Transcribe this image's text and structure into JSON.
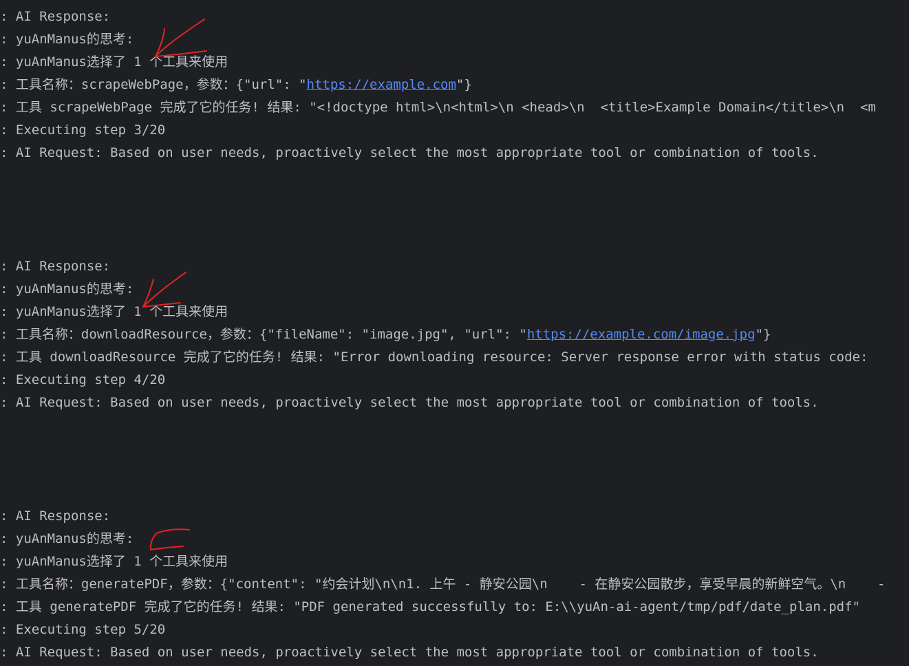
{
  "blocks": [
    {
      "response": ": AI Response:",
      "thinking": ": yuAnManus的思考:",
      "selected": ": yuAnManus选择了 1 个工具来使用",
      "tool_call_prefix": ": 工具名称：scrapeWebPage，参数：{\"url\": \"",
      "tool_call_link": "https://example.com",
      "tool_call_suffix": "\"}",
      "tool_result": ": 工具 scrapeWebPage 完成了它的任务! 结果: \"<!doctype html>\\n<html>\\n <head>\\n  <title>Example Domain</title>\\n  <m",
      "executing": ": Executing step 3/20",
      "request": ": AI Request: Based on user needs, proactively select the most appropriate tool or combination of tools."
    },
    {
      "response": ": AI Response:",
      "thinking": ": yuAnManus的思考:",
      "selected": ": yuAnManus选择了 1 个工具来使用",
      "tool_call_prefix": ": 工具名称：downloadResource，参数：{\"fileName\": \"image.jpg\", \"url\": \"",
      "tool_call_link": "https://example.com/image.jpg",
      "tool_call_suffix": "\"}",
      "tool_result": ": 工具 downloadResource 完成了它的任务! 结果: \"Error downloading resource: Server response error with status code: ",
      "executing": ": Executing step 4/20",
      "request": ": AI Request: Based on user needs, proactively select the most appropriate tool or combination of tools."
    },
    {
      "response": ": AI Response:",
      "thinking": ": yuAnManus的思考:",
      "selected": ": yuAnManus选择了 1 个工具来使用",
      "tool_call_prefix": ": 工具名称：generatePDF，参数：{\"content\": \"约会计划\\n\\n1. 上午 - 静安公园\\n    - 在静安公园散步，享受早晨的新鲜空气。\\n    -",
      "tool_call_link": "",
      "tool_call_suffix": "",
      "tool_result": ": 工具 generatePDF 完成了它的任务! 结果: \"PDF generated successfully to: E:\\\\yuAn-ai-agent/tmp/pdf/date_plan.pdf\"",
      "executing": ": Executing step 5/20",
      "request": ": AI Request: Based on user needs, proactively select the most appropriate tool or combination of tools."
    }
  ],
  "colors": {
    "background": "#1e1f22",
    "text": "#bcbec4",
    "link": "#548af7",
    "annotation": "#e02424"
  }
}
